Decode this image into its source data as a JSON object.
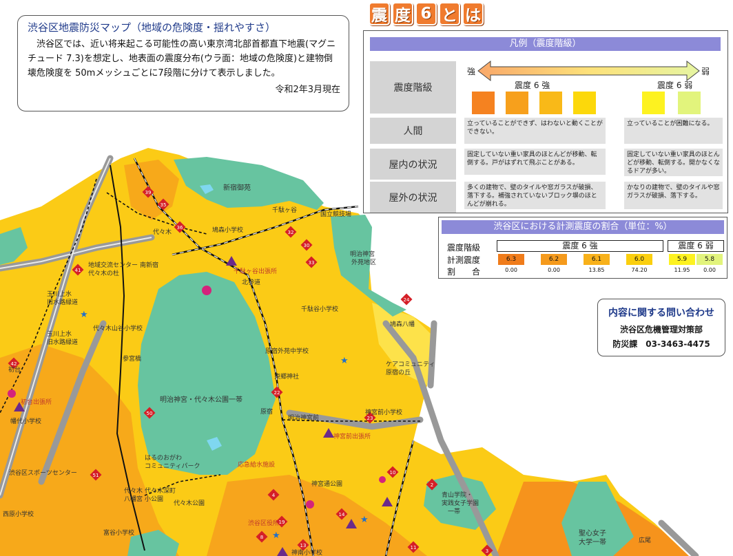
{
  "info": {
    "title": "渋谷区地震防災マップ（地域の危険度・揺れやすさ）",
    "body": "渋谷区では、近い将来起こる可能性の高い東京湾北部首都直下地震(マグニチュード 7.3)を想定し、地表面の震度分布(ウラ面：地域の危険度)と建物倒壊危険度を 50mメッシュごとに7段階に分けて表示しました。",
    "date": "令和2年3月現在"
  },
  "banner": {
    "chars": [
      "震",
      "度",
      "6",
      "と",
      "は"
    ]
  },
  "legend": {
    "header": "凡例（震度階級）",
    "strong_label": "強",
    "weak_label": "弱",
    "rows": {
      "level": "震度階級",
      "human": "人間",
      "indoor": "屋内の状況",
      "outdoor": "屋外の状況"
    },
    "upper": {
      "name": "震度 6 強",
      "colors": [
        "#f58220",
        "#f7a01c",
        "#f9b918",
        "#fcd80b"
      ],
      "human": "立っていることができず、はわないと動くことができない。",
      "indoor": "固定していない重い家具のほとんどが移動、転倒する。戸がはずれて飛ぶことがある。",
      "outdoor": "多くの建物で、壁のタイルや窓ガラスが破損、落下する。補強されていないブロック塀のほとんどが崩れる。"
    },
    "lower": {
      "name": "震度 6 弱",
      "colors": [
        "#fdf220",
        "#e2f47c"
      ],
      "human": "立っていることが困難になる。",
      "indoor": "固定していない重い家具のほとんどが移動、転倒する。開かなくなるドアが多い。",
      "outdoor": "かなりの建物で、壁のタイルや窓ガラスが破損、落下する。"
    }
  },
  "ratio": {
    "header": "渋谷区における計測震度の割合（単位：%）",
    "row_level": "震度階級",
    "row_measured": "計測震度",
    "row_ratio": "割　　合",
    "group_upper": "震度 6 強",
    "group_lower": "震度 6 弱",
    "cells": [
      {
        "measured": "6.3",
        "ratio": "0.00",
        "color": "#f07c1b"
      },
      {
        "measured": "6.2",
        "ratio": "0.00",
        "color": "#f59a1c"
      },
      {
        "measured": "6.1",
        "ratio": "13.85",
        "color": "#f8b11a"
      },
      {
        "measured": "6.0",
        "ratio": "74.20",
        "color": "#fbcf0e"
      },
      {
        "measured": "5.9",
        "ratio": "11.95",
        "color": "#fdf220"
      },
      {
        "measured": "5.8",
        "ratio": "0.00",
        "color": "#e2f47c"
      }
    ]
  },
  "contact": {
    "title": "内容に関する問い合わせ",
    "org": "渋谷区危機管理対策部",
    "tel": "防災課　03-3463-4475"
  },
  "map": {
    "labels": {
      "shinjuku_gyoen": "新宿御苑",
      "sendagaya": "千駄ヶ谷",
      "kokuritsu": "国立競技場",
      "meiji_gaien": "明治神宮外苑地区",
      "yoyogi_park": "明治神宮・代々木公園一帯",
      "harajuku": "原宿",
      "minami_shinjuku": "南新宿",
      "yoyogi": "代々木",
      "kitasando": "北参道",
      "sangubashi": "参宮橋",
      "meiji_jingumae": "明治神宮前",
      "sendagaya_office": "千駄ヶ谷出張所",
      "jingumae_office": "神宮前出張所",
      "hatsudai_office": "初台出張所",
      "yoyogi_hachiman": "代々木八幡",
      "aoyama": "青山学院・実践女子学園一帯",
      "seishin": "聖心女子大学一帯",
      "hiroo": "広尾",
      "shibuya_ward_office": "渋谷区役所",
      "tougou": "東郷神社",
      "hatagaya": "幡代小学校",
      "sports_center": "渋谷区スポーツセンター",
      "nishihara": "西原小学校",
      "tomigaya": "富谷小学校",
      "oyasumi": "応急給水施設",
      "hatogamori": "鳩森小学校",
      "sendagaya_sho": "千駄谷小学校",
      "jingumae_sho": "神宮前小学校",
      "harajuku_gaien": "原宿外苑中学校",
      "yoyogi_sanno": "代々木山谷小学校",
      "tamagawa1": "玉川上水旧水路緑道",
      "tamagawa2": "玉川上水旧水路緑道",
      "shinjuku_gyoen_label2": "新宿御苑",
      "community": "ケアコミュニティ原宿の丘",
      "hatonomori": "鳩森八幡",
      "hatsudai": "初台",
      "yoyogi_midori": "代々木深町小公園",
      "harunoogawa": "はるのおがわコミュニティパーク",
      "chiiki": "地域交流センター代々木の杜",
      "yoyogi_koen": "代々木公園",
      "kamiyama": "神南小学校",
      "jinnan": "神宮通公園"
    }
  }
}
